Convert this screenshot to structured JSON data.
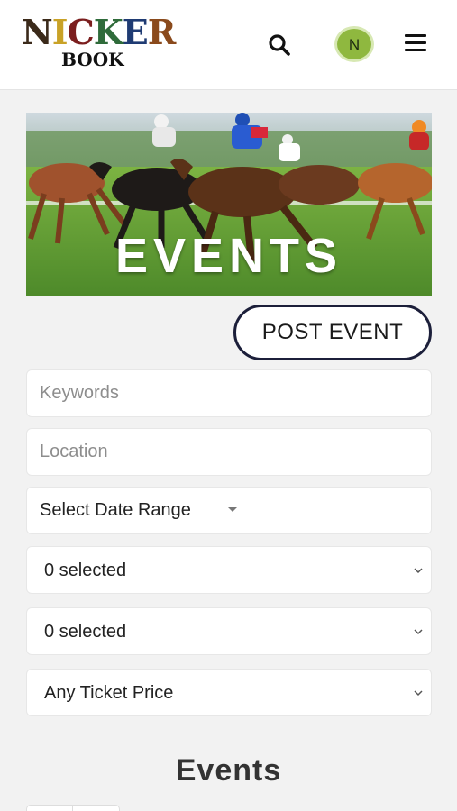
{
  "header": {
    "logo_line1": "NICKER",
    "logo_line2": "BOOK",
    "avatar_initial": "N",
    "avatar_color": "#8fb83f"
  },
  "banner": {
    "title": "EVENTS",
    "image_icon": "horse-racing-photo"
  },
  "actions": {
    "post_event_label": "POST EVENT"
  },
  "filters": {
    "keywords": {
      "placeholder": "Keywords",
      "value": ""
    },
    "location": {
      "placeholder": "Location",
      "value": ""
    },
    "date_range": {
      "label": "Select Date Range"
    },
    "select_1": {
      "value": "0 selected"
    },
    "select_2": {
      "value": "0 selected"
    },
    "ticket_price": {
      "value": "Any Ticket Price"
    }
  },
  "main": {
    "section_title": "Events"
  },
  "colors": {
    "button_border": "#1c1f3a",
    "page_bg": "#f2f2f2"
  }
}
